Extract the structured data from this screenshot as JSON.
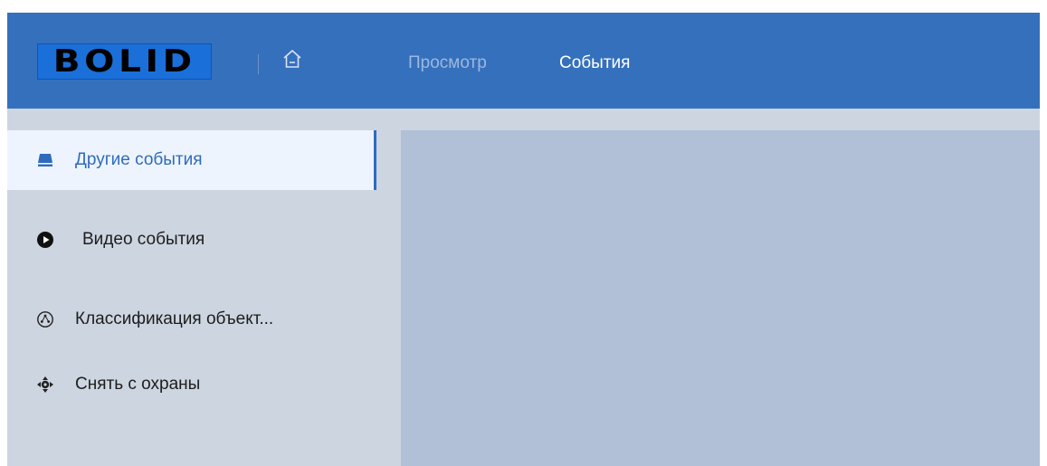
{
  "header": {
    "logo_text": "BOLID",
    "nav": [
      "Просмотр",
      "События"
    ],
    "active_nav": "События",
    "colors": {
      "bar": "#3570bd",
      "active": "#ffffff",
      "inactive": "#9db8de"
    }
  },
  "sidebar": {
    "items": [
      {
        "label": "Другие события",
        "icon": "storage-icon",
        "active": true
      },
      {
        "label": "Видео события",
        "icon": "play-circle-icon",
        "active": false
      },
      {
        "label": "Классификация объект...",
        "icon": "object-classification-icon",
        "active": false
      },
      {
        "label": "Снять с охраны",
        "icon": "disarm-crosshair-icon",
        "active": false
      }
    ],
    "accent_color": "#2f6bbd"
  }
}
